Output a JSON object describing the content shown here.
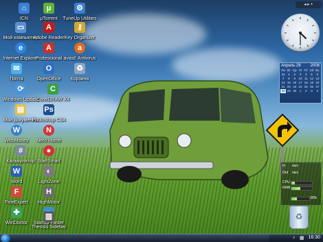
{
  "desktop_icons": [
    {
      "label": "ICN",
      "icon": "network-icon",
      "color": "#3d7fd6"
    },
    {
      "label": "Мой компьютер",
      "icon": "computer-icon",
      "color": "#5b8fd1"
    },
    {
      "label": "Internet Explorer",
      "icon": "internet-explorer-icon",
      "color": "#2d84e0"
    },
    {
      "label": "Почта",
      "icon": "mail-icon",
      "color": "#4fb0e8"
    },
    {
      "label": "Windows Update",
      "icon": "windows-update-icon",
      "color": "#4b93d8"
    },
    {
      "label": "Мои документы",
      "icon": "documents-folder-icon",
      "color": "#e3c04d"
    },
    {
      "label": "WebMoney",
      "icon": "webmoney-icon",
      "color": "#3c7fc8"
    },
    {
      "label": "Калькулятор",
      "icon": "calculator-icon",
      "color": "#7a8a9a"
    },
    {
      "label": "Word",
      "icon": "word-icon",
      "color": "#2b5fb7"
    },
    {
      "label": "FineExpert",
      "icon": "fineexpert-icon",
      "color": "#d14a3c"
    },
    {
      "label": "WinDoctor",
      "icon": "windoctor-icon",
      "color": "#3aa05a"
    },
    {
      "label": "μTorrent",
      "icon": "utorrent-icon",
      "color": "#5fb336"
    },
    {
      "label": "Adobe Reader",
      "icon": "adobe-reader-icon",
      "color": "#c01d1d"
    },
    {
      "label": "Professional",
      "icon": "acrobat-professional-icon",
      "color": "#c8322d"
    },
    {
      "label": "OpenOffice",
      "icon": "openoffice-icon",
      "color": "#2f6fbf"
    },
    {
      "label": "CorelDRAW X4",
      "icon": "coreldraw-icon",
      "color": "#3a9f43"
    },
    {
      "label": "Photoshop CS4",
      "icon": "photoshop-icon",
      "color": "#1e4f8a"
    },
    {
      "label": "Nero Home",
      "icon": "nero-icon",
      "color": "#d13434"
    },
    {
      "label": "StartSmart",
      "icon": "startsmart-icon",
      "color": "#d13434"
    },
    {
      "label": "LightZone",
      "icon": "lightzone-icon",
      "color": "#7a7a7a"
    },
    {
      "label": "HighMotor",
      "icon": "highmotor-icon",
      "color": "#6b6b6b"
    },
    {
      "label": "Startup Faster",
      "icon": "startup-faster-icon",
      "color": "#3c8ed4"
    },
    {
      "label": "Theosis Sidebar",
      "icon": "sidebar-icon",
      "color": "#5c5c5c"
    },
    {
      "label": "TuneUp Utilities",
      "icon": "tuneup-icon",
      "color": "#3a7fd0"
    },
    {
      "label": "Key Organizer",
      "icon": "key-organizer-icon",
      "color": "#d4a72c"
    },
    {
      "label": "avast! Antivirus",
      "icon": "avast-icon",
      "color": "#e06b1f"
    },
    {
      "label": "Корзина",
      "icon": "recycle-bin-icon",
      "color": "#8aa7c2"
    }
  ],
  "clock_gadget": {
    "hour": 4,
    "minute": 30
  },
  "calendar": {
    "month": "Апрель 28",
    "year": "2008",
    "weekdays": [
      "Пн",
      "Вт",
      "Ср",
      "Чт",
      "Пт",
      "Сб",
      "Вс"
    ],
    "days": [
      "31",
      "1",
      "2",
      "3",
      "4",
      "5",
      "6",
      "7",
      "8",
      "9",
      "10",
      "11",
      "12",
      "13",
      "14",
      "15",
      "16",
      "17",
      "18",
      "19",
      "20",
      "21",
      "22",
      "23",
      "24",
      "25",
      "26",
      "27",
      "28",
      "29",
      "30",
      "1",
      "2",
      "3",
      "4"
    ],
    "today": "28"
  },
  "system_monitor": {
    "in_label": "In",
    "in_value": "0B/s",
    "out_label": "Out",
    "out_value": "0B/s",
    "cpu_label": "CPU",
    "cpu_percent": 18,
    "ram_label": "RAM",
    "ram_percent": 42,
    "disk_percent_label": "30%",
    "disk_percent": 30
  },
  "taskbar": {
    "time": "16:30"
  }
}
